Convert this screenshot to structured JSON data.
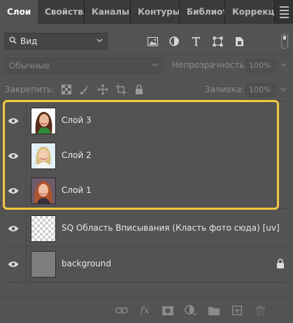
{
  "tabs": [
    {
      "label": "Слои",
      "active": true
    },
    {
      "label": "Свойства",
      "active": false
    },
    {
      "label": "Каналы",
      "active": false
    },
    {
      "label": "Контуры",
      "active": false
    },
    {
      "label": "Библиот",
      "active": false
    },
    {
      "label": "Коррекц",
      "active": false
    }
  ],
  "filter": {
    "label": "Вид",
    "icons": [
      "image-filter-icon",
      "adjustment-filter-icon",
      "type-filter-icon",
      "shape-filter-icon",
      "smart-object-filter-icon"
    ]
  },
  "blend": {
    "mode": "Обычные",
    "opacity_label": "Непрозрачность:",
    "opacity_value": "100%"
  },
  "lock": {
    "label": "Закрепить:",
    "fill_label": "Заливка:",
    "fill_value": "100%"
  },
  "layers": [
    {
      "name": "Слой 3",
      "visible": true,
      "selected": true,
      "thumb": "portrait-green"
    },
    {
      "name": "Слой 2",
      "visible": true,
      "selected": true,
      "thumb": "portrait-blond"
    },
    {
      "name": "Слой 1",
      "visible": true,
      "selected": true,
      "thumb": "portrait-redhead"
    },
    {
      "name": "SQ Область Вписывания (Класть фото сюда) [uv]",
      "visible": true,
      "selected": false,
      "thumb": "transparent"
    },
    {
      "name": "background",
      "visible": true,
      "selected": false,
      "thumb": "gray",
      "locked": true
    }
  ],
  "bottom_bar": [
    "link-icon",
    "fx-icon",
    "mask-icon",
    "adjustment-icon",
    "folder-icon",
    "new-layer-icon",
    "trash-icon"
  ],
  "colors": {
    "highlight": "#f6c83d",
    "panel": "#535353",
    "tabbar": "#323232"
  }
}
